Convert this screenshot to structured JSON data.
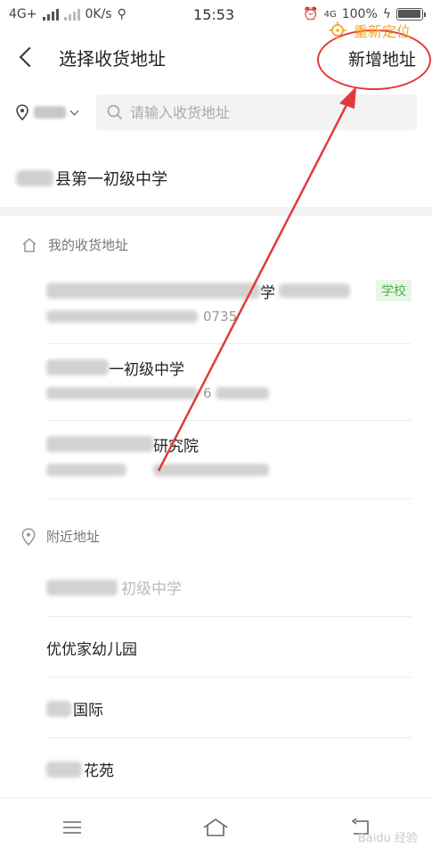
{
  "status_bar": {
    "network": "4G+",
    "speed": "0K/s",
    "time": "15:53",
    "network_right": "4G",
    "battery": "100%",
    "battery_level": 1.0
  },
  "header": {
    "title": "选择收货地址",
    "add_label": "新增地址"
  },
  "search": {
    "placeholder": "请输入收货地址"
  },
  "current_location": {
    "text": "县第一初级中学",
    "relocate_label": "重新定位",
    "accent_color": "#f5a623"
  },
  "my_addresses": {
    "heading": "我的收货地址",
    "items": [
      {
        "line1": "学",
        "line2": "0735",
        "tag": "学校"
      },
      {
        "line1": "一初级中学",
        "line2": "6",
        "tag": ""
      },
      {
        "line1": "研究院",
        "line2": "",
        "tag": ""
      }
    ]
  },
  "nearby": {
    "heading": "附近地址",
    "items": [
      {
        "label": "初级中学"
      },
      {
        "label": "优优家幼儿园"
      },
      {
        "label": "国际"
      },
      {
        "label": "花苑"
      }
    ]
  },
  "icons": {
    "location": "location-pin-icon",
    "search": "search-icon",
    "home": "home-icon",
    "relocate": "crosshair-icon"
  },
  "annotation_color": "#e23a3a",
  "watermark": "Baidu 经验"
}
